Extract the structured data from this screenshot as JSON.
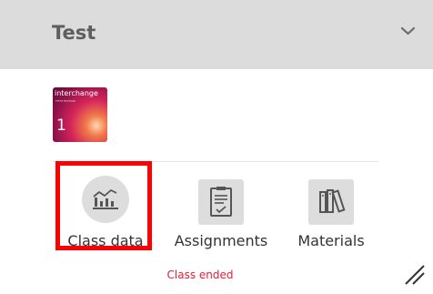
{
  "header": {
    "title": "Test",
    "toggle_icon": "chevron-down-icon"
  },
  "book": {
    "cover_title": "interchange",
    "cover_subtitle": "FIFTH EDITION",
    "cover_number": "1"
  },
  "actions": [
    {
      "label": "Class data",
      "icon": "bar-chart-icon",
      "highlighted": true
    },
    {
      "label": "Assignments",
      "icon": "clipboard-icon",
      "highlighted": false
    },
    {
      "label": "Materials",
      "icon": "books-icon",
      "highlighted": false
    }
  ],
  "status": {
    "text": "Class ended",
    "color": "#e0203a"
  },
  "colors": {
    "header_bg": "#dcdcdc",
    "highlight": "#ff0000",
    "icon_bg": "#dddddd"
  }
}
